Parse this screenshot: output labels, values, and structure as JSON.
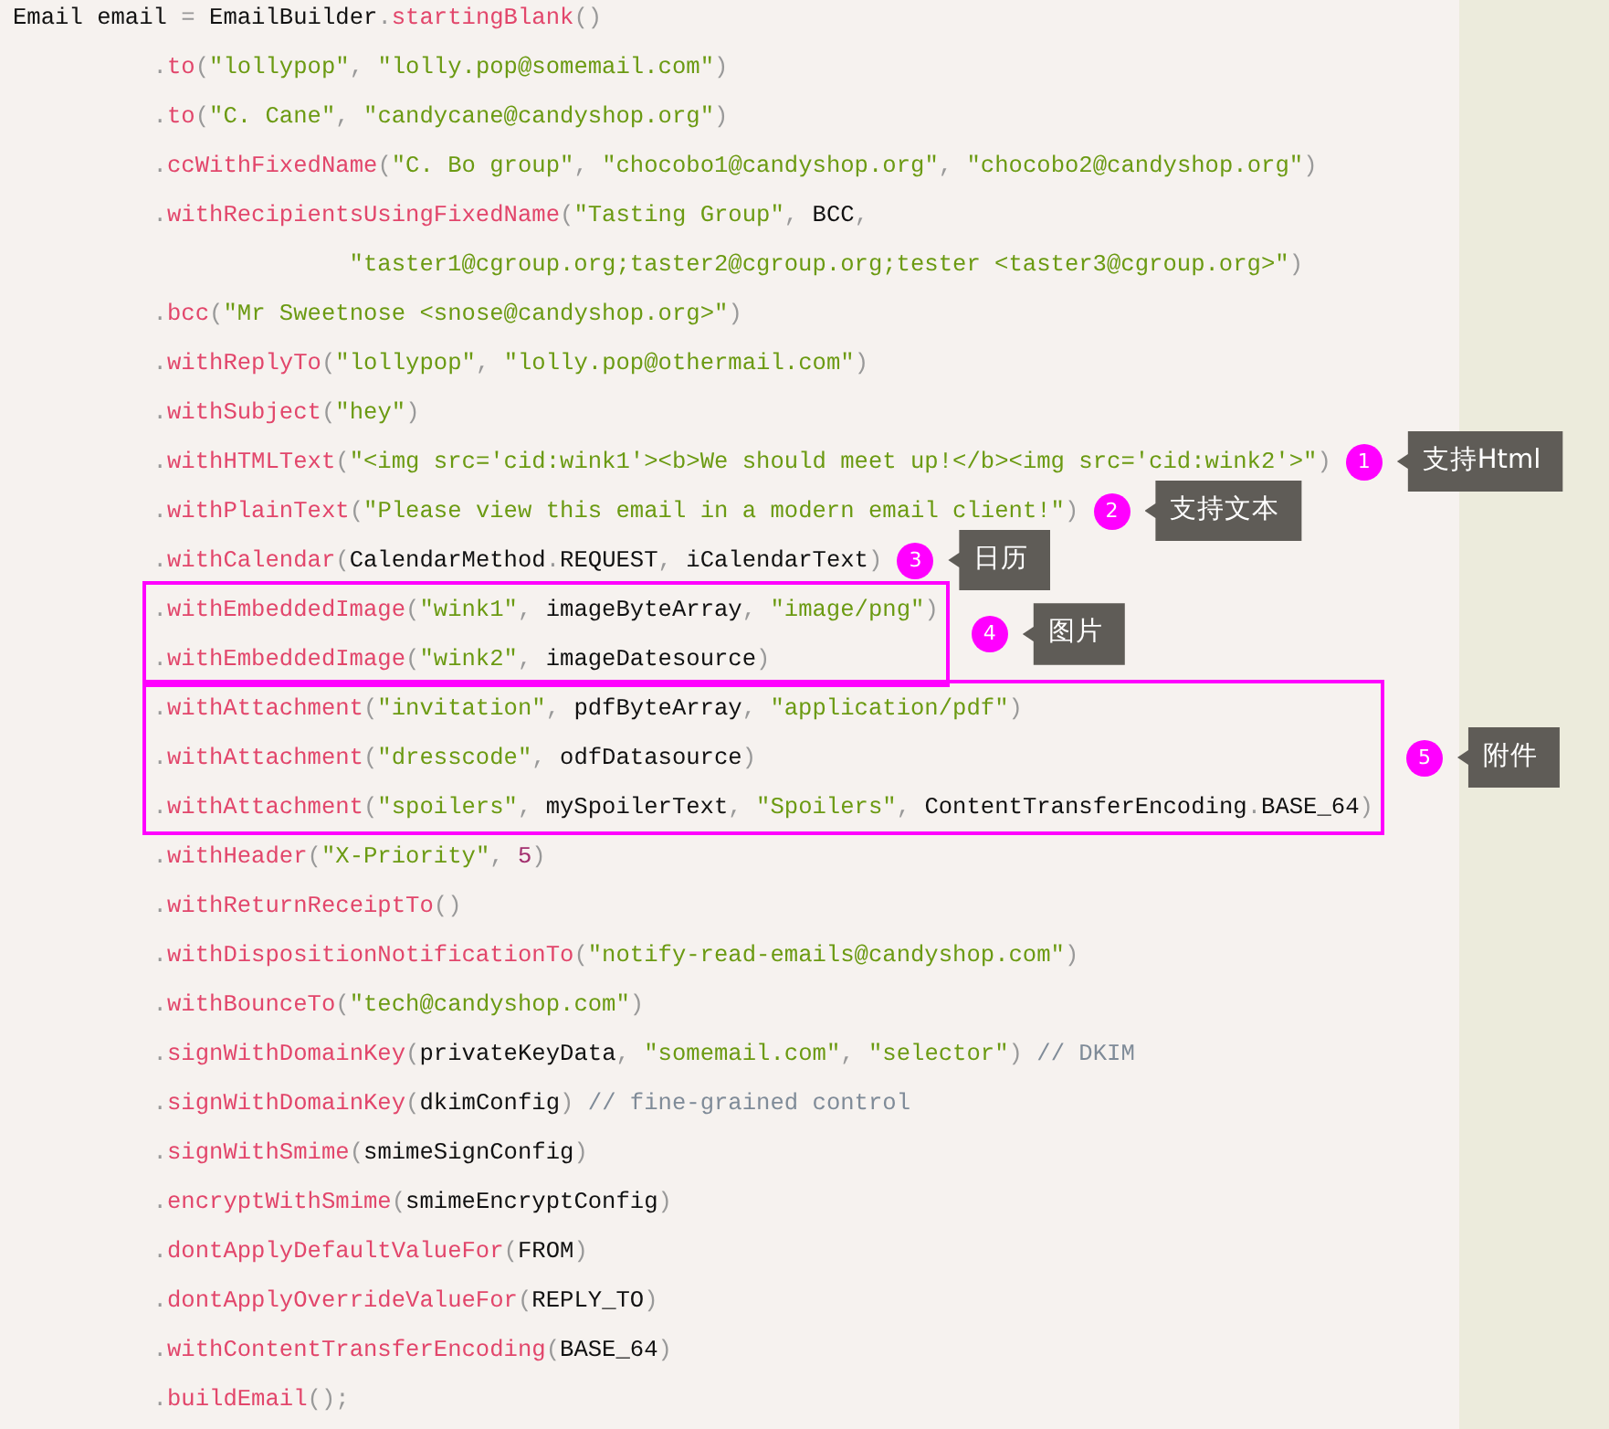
{
  "code": [
    {
      "kind": "line",
      "tokens": [
        {
          "kind": "ident",
          "text": "Email email "
        },
        {
          "kind": "punct",
          "text": "="
        },
        {
          "kind": "ident",
          "text": " EmailBuilder"
        },
        {
          "kind": "punct",
          "text": "."
        },
        {
          "kind": "method",
          "text": "startingBlank"
        },
        {
          "kind": "punct",
          "text": "()"
        }
      ]
    },
    {
      "kind": "line",
      "tokens": [
        {
          "kind": "punct",
          "text": "          ."
        },
        {
          "kind": "method",
          "text": "to"
        },
        {
          "kind": "punct",
          "text": "("
        },
        {
          "kind": "string",
          "text": "\"lollypop\""
        },
        {
          "kind": "punct",
          "text": ", "
        },
        {
          "kind": "string",
          "text": "\"lolly.pop@somemail.com\""
        },
        {
          "kind": "punct",
          "text": ")"
        }
      ]
    },
    {
      "kind": "line",
      "tokens": [
        {
          "kind": "punct",
          "text": "          ."
        },
        {
          "kind": "method",
          "text": "to"
        },
        {
          "kind": "punct",
          "text": "("
        },
        {
          "kind": "string",
          "text": "\"C. Cane\""
        },
        {
          "kind": "punct",
          "text": ", "
        },
        {
          "kind": "string",
          "text": "\"candycane@candyshop.org\""
        },
        {
          "kind": "punct",
          "text": ")"
        }
      ]
    },
    {
      "kind": "line",
      "tokens": [
        {
          "kind": "punct",
          "text": "          ."
        },
        {
          "kind": "method",
          "text": "ccWithFixedName"
        },
        {
          "kind": "punct",
          "text": "("
        },
        {
          "kind": "string",
          "text": "\"C. Bo group\""
        },
        {
          "kind": "punct",
          "text": ", "
        },
        {
          "kind": "string",
          "text": "\"chocobo1@candyshop.org\""
        },
        {
          "kind": "punct",
          "text": ", "
        },
        {
          "kind": "string",
          "text": "\"chocobo2@candyshop.org\""
        },
        {
          "kind": "punct",
          "text": ")"
        }
      ]
    },
    {
      "kind": "line",
      "tokens": [
        {
          "kind": "punct",
          "text": "          ."
        },
        {
          "kind": "method",
          "text": "withRecipientsUsingFixedName"
        },
        {
          "kind": "punct",
          "text": "("
        },
        {
          "kind": "string",
          "text": "\"Tasting Group\""
        },
        {
          "kind": "punct",
          "text": ", "
        },
        {
          "kind": "ident",
          "text": "BCC"
        },
        {
          "kind": "punct",
          "text": ","
        }
      ]
    },
    {
      "kind": "line",
      "tokens": [
        {
          "kind": "string",
          "text": "                        \"taster1@cgroup.org;taster2@cgroup.org;tester <taster3@cgroup.org>\""
        },
        {
          "kind": "punct",
          "text": ")"
        }
      ]
    },
    {
      "kind": "line",
      "tokens": [
        {
          "kind": "punct",
          "text": "          ."
        },
        {
          "kind": "method",
          "text": "bcc"
        },
        {
          "kind": "punct",
          "text": "("
        },
        {
          "kind": "string",
          "text": "\"Mr Sweetnose <snose@candyshop.org>\""
        },
        {
          "kind": "punct",
          "text": ")"
        }
      ]
    },
    {
      "kind": "line",
      "tokens": [
        {
          "kind": "punct",
          "text": "          ."
        },
        {
          "kind": "method",
          "text": "withReplyTo"
        },
        {
          "kind": "punct",
          "text": "("
        },
        {
          "kind": "string",
          "text": "\"lollypop\""
        },
        {
          "kind": "punct",
          "text": ", "
        },
        {
          "kind": "string",
          "text": "\"lolly.pop@othermail.com\""
        },
        {
          "kind": "punct",
          "text": ")"
        }
      ]
    },
    {
      "kind": "line",
      "tokens": [
        {
          "kind": "punct",
          "text": "          ."
        },
        {
          "kind": "method",
          "text": "withSubject"
        },
        {
          "kind": "punct",
          "text": "("
        },
        {
          "kind": "string",
          "text": "\"hey\""
        },
        {
          "kind": "punct",
          "text": ")"
        }
      ]
    },
    {
      "kind": "line",
      "tokens": [
        {
          "kind": "punct",
          "text": "          ."
        },
        {
          "kind": "method",
          "text": "withHTMLText"
        },
        {
          "kind": "punct",
          "text": "("
        },
        {
          "kind": "string",
          "text": "\"<img src='cid:wink1'><b>We should meet up!</b><img src='cid:wink2'>\""
        },
        {
          "kind": "punct",
          "text": ")"
        }
      ],
      "note": {
        "number": "1",
        "label": "支持Html"
      }
    },
    {
      "kind": "line",
      "tokens": [
        {
          "kind": "punct",
          "text": "          ."
        },
        {
          "kind": "method",
          "text": "withPlainText"
        },
        {
          "kind": "punct",
          "text": "("
        },
        {
          "kind": "string",
          "text": "\"Please view this email in a modern email client!\""
        },
        {
          "kind": "punct",
          "text": ")"
        }
      ],
      "note": {
        "number": "2",
        "label": "支持文本"
      }
    },
    {
      "kind": "line",
      "tokens": [
        {
          "kind": "punct",
          "text": "          ."
        },
        {
          "kind": "method",
          "text": "withCalendar"
        },
        {
          "kind": "punct",
          "text": "("
        },
        {
          "kind": "ident",
          "text": "CalendarMethod"
        },
        {
          "kind": "punct",
          "text": "."
        },
        {
          "kind": "ident",
          "text": "REQUEST"
        },
        {
          "kind": "punct",
          "text": ", "
        },
        {
          "kind": "ident",
          "text": "iCalendarText"
        },
        {
          "kind": "punct",
          "text": ")"
        }
      ],
      "note": {
        "number": "3",
        "label": "日历"
      }
    },
    {
      "kind": "frame",
      "lines": [
        {
          "tokens": [
            {
              "kind": "punct",
              "text": "."
            },
            {
              "kind": "method",
              "text": "withEmbeddedImage"
            },
            {
              "kind": "punct",
              "text": "("
            },
            {
              "kind": "string",
              "text": "\"wink1\""
            },
            {
              "kind": "punct",
              "text": ", "
            },
            {
              "kind": "ident",
              "text": "imageByteArray"
            },
            {
              "kind": "punct",
              "text": ", "
            },
            {
              "kind": "string",
              "text": "\"image/png\""
            },
            {
              "kind": "punct",
              "text": ")"
            }
          ]
        },
        {
          "tokens": [
            {
              "kind": "punct",
              "text": "."
            },
            {
              "kind": "method",
              "text": "withEmbeddedImage"
            },
            {
              "kind": "punct",
              "text": "("
            },
            {
              "kind": "string",
              "text": "\"wink2\""
            },
            {
              "kind": "punct",
              "text": ", "
            },
            {
              "kind": "ident",
              "text": "imageDatesource"
            },
            {
              "kind": "punct",
              "text": ")"
            }
          ]
        }
      ],
      "note": {
        "number": "4",
        "label": "图片"
      }
    },
    {
      "kind": "frame",
      "lines": [
        {
          "tokens": [
            {
              "kind": "punct",
              "text": "."
            },
            {
              "kind": "method",
              "text": "withAttachment"
            },
            {
              "kind": "punct",
              "text": "("
            },
            {
              "kind": "string",
              "text": "\"invitation\""
            },
            {
              "kind": "punct",
              "text": ", "
            },
            {
              "kind": "ident",
              "text": "pdfByteArray"
            },
            {
              "kind": "punct",
              "text": ", "
            },
            {
              "kind": "string",
              "text": "\"application/pdf\""
            },
            {
              "kind": "punct",
              "text": ")"
            }
          ]
        },
        {
          "tokens": [
            {
              "kind": "punct",
              "text": "."
            },
            {
              "kind": "method",
              "text": "withAttachment"
            },
            {
              "kind": "punct",
              "text": "("
            },
            {
              "kind": "string",
              "text": "\"dresscode\""
            },
            {
              "kind": "punct",
              "text": ", "
            },
            {
              "kind": "ident",
              "text": "odfDatasource"
            },
            {
              "kind": "punct",
              "text": ")"
            }
          ]
        },
        {
          "tokens": [
            {
              "kind": "punct",
              "text": "."
            },
            {
              "kind": "method",
              "text": "withAttachment"
            },
            {
              "kind": "punct",
              "text": "("
            },
            {
              "kind": "string",
              "text": "\"spoilers\""
            },
            {
              "kind": "punct",
              "text": ", "
            },
            {
              "kind": "ident",
              "text": "mySpoilerText"
            },
            {
              "kind": "punct",
              "text": ", "
            },
            {
              "kind": "string",
              "text": "\"Spoilers\""
            },
            {
              "kind": "punct",
              "text": ", "
            },
            {
              "kind": "ident",
              "text": "ContentTransferEncoding"
            },
            {
              "kind": "punct",
              "text": "."
            },
            {
              "kind": "ident",
              "text": "BASE_64"
            },
            {
              "kind": "punct",
              "text": ")"
            }
          ]
        }
      ],
      "note": {
        "number": "5",
        "label": "附件"
      }
    },
    {
      "kind": "line",
      "tokens": [
        {
          "kind": "punct",
          "text": "          ."
        },
        {
          "kind": "method",
          "text": "withHeader"
        },
        {
          "kind": "punct",
          "text": "("
        },
        {
          "kind": "string",
          "text": "\"X-Priority\""
        },
        {
          "kind": "punct",
          "text": ", "
        },
        {
          "kind": "number",
          "text": "5"
        },
        {
          "kind": "punct",
          "text": ")"
        }
      ]
    },
    {
      "kind": "line",
      "tokens": [
        {
          "kind": "punct",
          "text": "          ."
        },
        {
          "kind": "method",
          "text": "withReturnReceiptTo"
        },
        {
          "kind": "punct",
          "text": "()"
        }
      ]
    },
    {
      "kind": "line",
      "tokens": [
        {
          "kind": "punct",
          "text": "          ."
        },
        {
          "kind": "method",
          "text": "withDispositionNotificationTo"
        },
        {
          "kind": "punct",
          "text": "("
        },
        {
          "kind": "string",
          "text": "\"notify-read-emails@candyshop.com\""
        },
        {
          "kind": "punct",
          "text": ")"
        }
      ]
    },
    {
      "kind": "line",
      "tokens": [
        {
          "kind": "punct",
          "text": "          ."
        },
        {
          "kind": "method",
          "text": "withBounceTo"
        },
        {
          "kind": "punct",
          "text": "("
        },
        {
          "kind": "string",
          "text": "\"tech@candyshop.com\""
        },
        {
          "kind": "punct",
          "text": ")"
        }
      ]
    },
    {
      "kind": "line",
      "tokens": [
        {
          "kind": "punct",
          "text": "          ."
        },
        {
          "kind": "method",
          "text": "signWithDomainKey"
        },
        {
          "kind": "punct",
          "text": "("
        },
        {
          "kind": "ident",
          "text": "privateKeyData"
        },
        {
          "kind": "punct",
          "text": ", "
        },
        {
          "kind": "string",
          "text": "\"somemail.com\""
        },
        {
          "kind": "punct",
          "text": ", "
        },
        {
          "kind": "string",
          "text": "\"selector\""
        },
        {
          "kind": "punct",
          "text": ") "
        },
        {
          "kind": "comment",
          "text": "// DKIM"
        }
      ]
    },
    {
      "kind": "line",
      "tokens": [
        {
          "kind": "punct",
          "text": "          ."
        },
        {
          "kind": "method",
          "text": "signWithDomainKey"
        },
        {
          "kind": "punct",
          "text": "("
        },
        {
          "kind": "ident",
          "text": "dkimConfig"
        },
        {
          "kind": "punct",
          "text": ") "
        },
        {
          "kind": "comment",
          "text": "// fine-grained control"
        }
      ]
    },
    {
      "kind": "line",
      "tokens": [
        {
          "kind": "punct",
          "text": "          ."
        },
        {
          "kind": "method",
          "text": "signWithSmime"
        },
        {
          "kind": "punct",
          "text": "("
        },
        {
          "kind": "ident",
          "text": "smimeSignConfig"
        },
        {
          "kind": "punct",
          "text": ")"
        }
      ]
    },
    {
      "kind": "line",
      "tokens": [
        {
          "kind": "punct",
          "text": "          ."
        },
        {
          "kind": "method",
          "text": "encryptWithSmime"
        },
        {
          "kind": "punct",
          "text": "("
        },
        {
          "kind": "ident",
          "text": "smimeEncryptConfig"
        },
        {
          "kind": "punct",
          "text": ")"
        }
      ]
    },
    {
      "kind": "line",
      "tokens": [
        {
          "kind": "punct",
          "text": "          ."
        },
        {
          "kind": "method",
          "text": "dontApplyDefaultValueFor"
        },
        {
          "kind": "punct",
          "text": "("
        },
        {
          "kind": "ident",
          "text": "FROM"
        },
        {
          "kind": "punct",
          "text": ")"
        }
      ]
    },
    {
      "kind": "line",
      "tokens": [
        {
          "kind": "punct",
          "text": "          ."
        },
        {
          "kind": "method",
          "text": "dontApplyOverrideValueFor"
        },
        {
          "kind": "punct",
          "text": "("
        },
        {
          "kind": "ident",
          "text": "REPLY_TO"
        },
        {
          "kind": "punct",
          "text": ")"
        }
      ]
    },
    {
      "kind": "line",
      "tokens": [
        {
          "kind": "punct",
          "text": "          ."
        },
        {
          "kind": "method",
          "text": "withContentTransferEncoding"
        },
        {
          "kind": "punct",
          "text": "("
        },
        {
          "kind": "ident",
          "text": "BASE_64"
        },
        {
          "kind": "punct",
          "text": ")"
        }
      ]
    },
    {
      "kind": "line",
      "tokens": [
        {
          "kind": "punct",
          "text": "          ."
        },
        {
          "kind": "method",
          "text": "buildEmail"
        },
        {
          "kind": "punct",
          "text": "();"
        }
      ]
    }
  ]
}
